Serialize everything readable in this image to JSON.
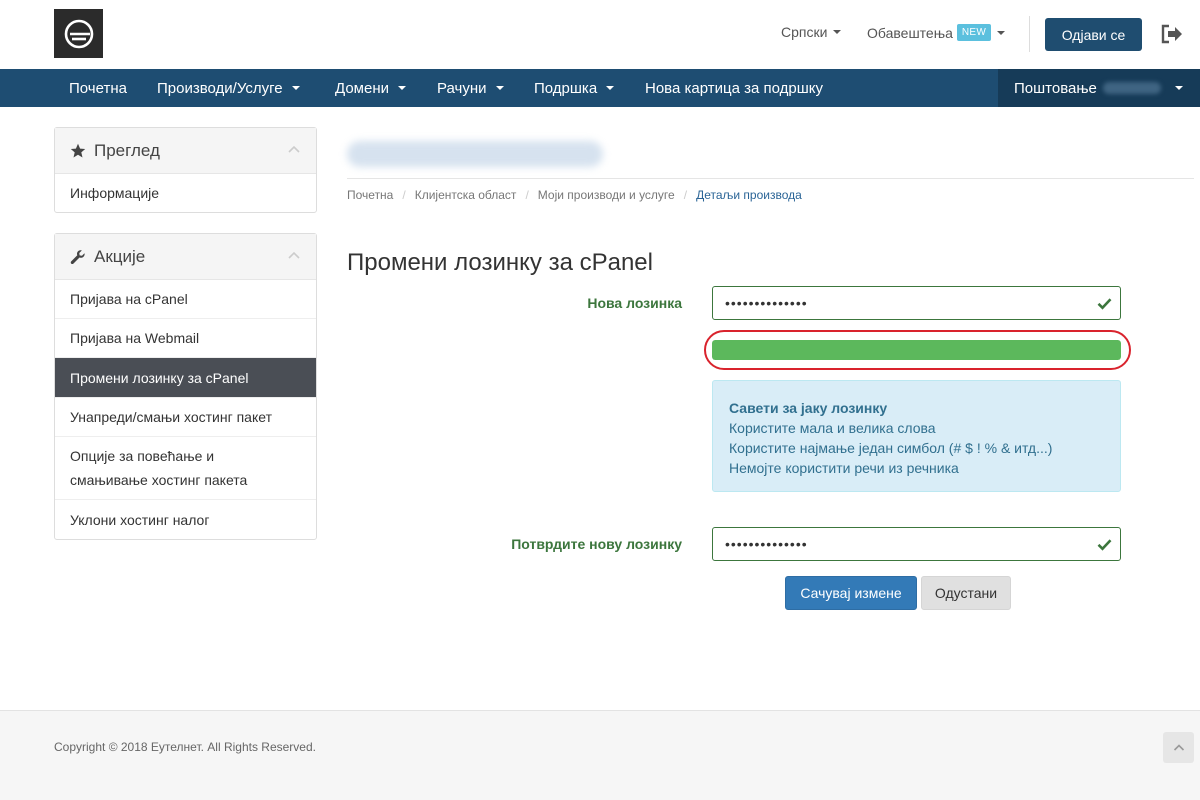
{
  "header": {
    "language": "Српски",
    "notifications": "Обавештења",
    "notifications_badge": "NEW",
    "logout_label": "Одјави се"
  },
  "nav": {
    "items": [
      {
        "label": "Почетна"
      },
      {
        "label": "Производи/Услуге"
      },
      {
        "label": "Домени"
      },
      {
        "label": "Рачуни"
      },
      {
        "label": "Подршка"
      },
      {
        "label": "Нова картица за подршку"
      }
    ],
    "greeting": "Поштовање"
  },
  "sidebar": {
    "overview": {
      "title": "Преглед",
      "items": [
        {
          "label": "Информације"
        }
      ]
    },
    "actions": {
      "title": "Акције",
      "items": [
        {
          "label": "Пријава на cPanel"
        },
        {
          "label": "Пријава на Webmail"
        },
        {
          "label": "Промени лозинку за cPanel"
        },
        {
          "label": "Унапреди/смањи хостинг пакет"
        },
        {
          "label": "Опције за повећање и смањивање хостинг пакета"
        },
        {
          "label": "Уклони хостинг налог"
        }
      ]
    }
  },
  "breadcrumb": [
    "Почетна",
    "Клијентска област",
    "Моји производи и услуге",
    "Детаљи производа"
  ],
  "main": {
    "heading": "Промени лозинку за cPanel",
    "new_password_label": "Нова лозинка",
    "new_password_value": "••••••••••••••",
    "strength": 1.0,
    "tips": {
      "title": "Савети за јаку лозинку",
      "lines": [
        "Користите мала и велика слова",
        "Користите најмање један симбол (# $ ! % & итд...)",
        "Немојте користити речи из речника"
      ]
    },
    "confirm_password_label": "Потврдите нову лозинку",
    "confirm_password_value": "••••••••••••••",
    "save_label": "Сачувај измене",
    "cancel_label": "Одустани"
  },
  "footer": {
    "copyright": "Copyright © 2018 Еутелнет. All Rights Reserved."
  },
  "colors": {
    "nav": "#1e4d72",
    "success": "#3c763d",
    "strength_bar": "#5cb85c",
    "highlight_ring": "#d9232d",
    "primary_button": "#337ab7"
  }
}
